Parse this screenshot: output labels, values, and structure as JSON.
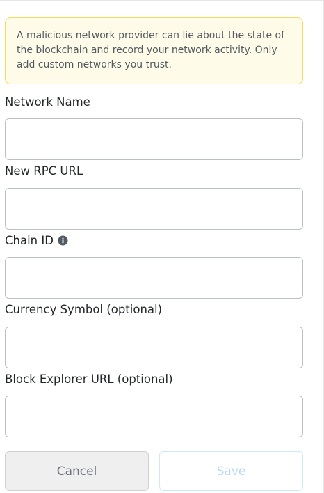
{
  "warning": {
    "text": "A malicious network provider can lie about the state of the blockchain and record your network activity. Only add custom networks you trust."
  },
  "fields": {
    "network_name": {
      "label": "Network Name",
      "value": ""
    },
    "rpc_url": {
      "label": "New RPC URL",
      "value": ""
    },
    "chain_id": {
      "label": "Chain ID",
      "value": "",
      "icon": "info-icon"
    },
    "currency_symbol": {
      "label": "Currency Symbol (optional)",
      "value": ""
    },
    "block_explorer": {
      "label": "Block Explorer URL (optional)",
      "value": ""
    }
  },
  "buttons": {
    "cancel_label": "Cancel",
    "save_label": "Save"
  },
  "colors": {
    "warning_background": "#fefbe8",
    "warning_border": "#f8d95a",
    "save_disabled_text": "#b5d9f0"
  }
}
